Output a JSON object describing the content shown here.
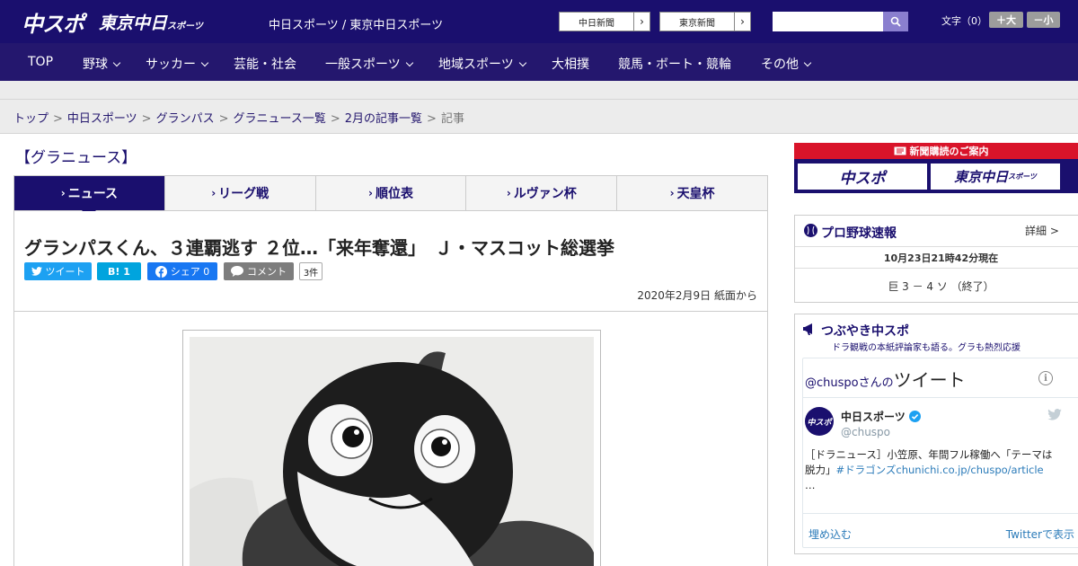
{
  "header": {
    "logo_main": "中スポ",
    "logo_sub": "東京中日",
    "logo_sub_small": "スポーツ",
    "site_names": "中日スポーツ / 東京中日スポーツ",
    "ext_buttons": [
      "中日新聞",
      "東京新聞"
    ],
    "fontsize_label": "文字（0）",
    "font_bigger": "＋大",
    "font_smaller": "－小"
  },
  "nav": {
    "items": [
      "TOP",
      "野球",
      "サッカー",
      "芸能・社会",
      "一般スポーツ",
      "地域スポーツ",
      "大相撲",
      "競馬・ボート・競輪",
      "その他"
    ]
  },
  "breadcrumb": {
    "items": [
      "トップ",
      "中日スポーツ",
      "グランパス",
      "グラニュース一覧",
      "2月の記事一覧"
    ],
    "current": "記事"
  },
  "section_title": "【グラニュース】",
  "tabs": [
    "ニュース",
    "リーグ戦",
    "順位表",
    "ルヴァン杯",
    "天皇杯"
  ],
  "article": {
    "title": "グランパスくん、３連覇逃す ２位…「来年奪還」　Ｊ・マスコット総選挙",
    "share": {
      "tweet": "ツイート",
      "hatena": "B! 1",
      "facebook": "シェア 0",
      "comment": "コメント",
      "comment_count": "3件"
    },
    "date": "2020年2月9日 紙面から"
  },
  "sidebar": {
    "ad_top": "新聞購読のご案内",
    "ad_logos": [
      "中スポ",
      "東京中日"
    ],
    "ad_logo_small": "スポーツ",
    "baseball": {
      "title": "プロ野球速報",
      "detail": "詳細 >",
      "updated": "10月23日21時42分現在",
      "score": "巨 3 － 4 ソ （終了）"
    },
    "tsubuyaki": {
      "title": "つぶやき中スポ",
      "subtitle": "ドラ観戦の本紙評論家も語る。グラも熱烈応援",
      "handle_prefix": "@chuspoさんの",
      "handle_big": "ツイート",
      "info": "i",
      "account_name": "中日スポーツ",
      "account_handle": "@chuspo",
      "avatar_text": "中スポ",
      "tweet_text": "［ドラニュース］小笠原、年間フル稼働へ「テーマは脱力」",
      "tweet_link": "#ドラゴンズchunichi.co.jp/chuspo/article",
      "tweet_more": "…",
      "embed": "埋め込む",
      "view_on_twitter": "Twitterで表示"
    }
  },
  "colors": {
    "header": "#1a0f6e",
    "nav": "#24176e",
    "active_tab": "#1a0f6e",
    "ad_red": "#d9142a",
    "twitter": "#1da1f2",
    "hatena": "#00a4de",
    "facebook": "#1877f2",
    "comment": "#7d7d7d"
  }
}
